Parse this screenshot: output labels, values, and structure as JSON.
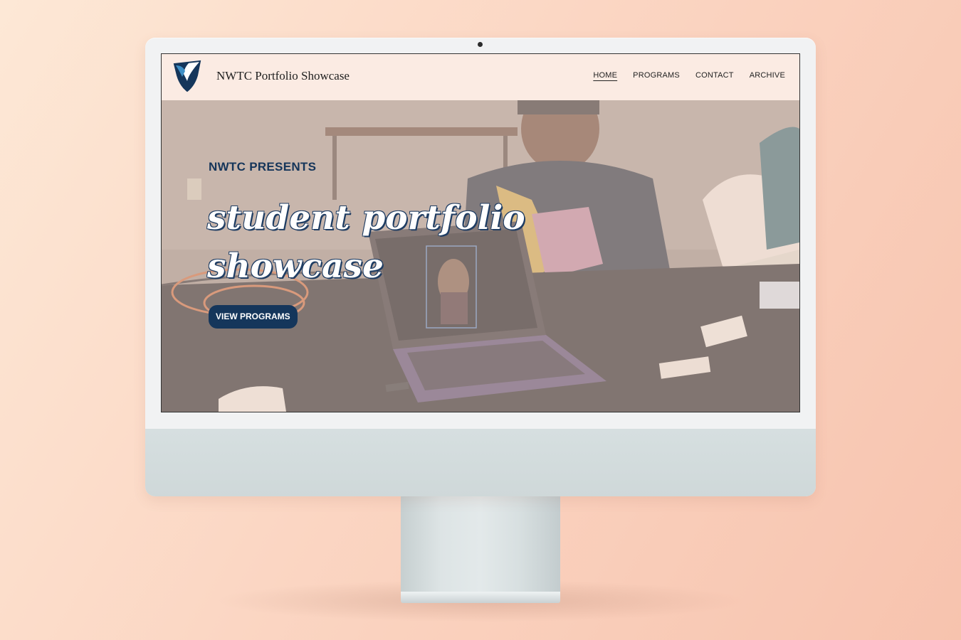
{
  "site": {
    "title": "NWTC Portfolio Showcase"
  },
  "nav": {
    "items": [
      {
        "label": "HOME",
        "active": true
      },
      {
        "label": "PROGRAMS",
        "active": false
      },
      {
        "label": "CONTACT",
        "active": false
      },
      {
        "label": "ARCHIVE",
        "active": false
      }
    ]
  },
  "hero": {
    "eyebrow": "NWTC PRESENTS",
    "headline_line1": "student portfolio",
    "headline_line2": "showcase",
    "cta_label": "VIEW PROGRAMS"
  },
  "colors": {
    "navy": "#15365b",
    "nav_background": "#fbebe3",
    "page_background_from": "#fde8d6",
    "page_background_to": "#f7c3ae"
  },
  "icons": {
    "logo": "shield-logo-icon"
  }
}
